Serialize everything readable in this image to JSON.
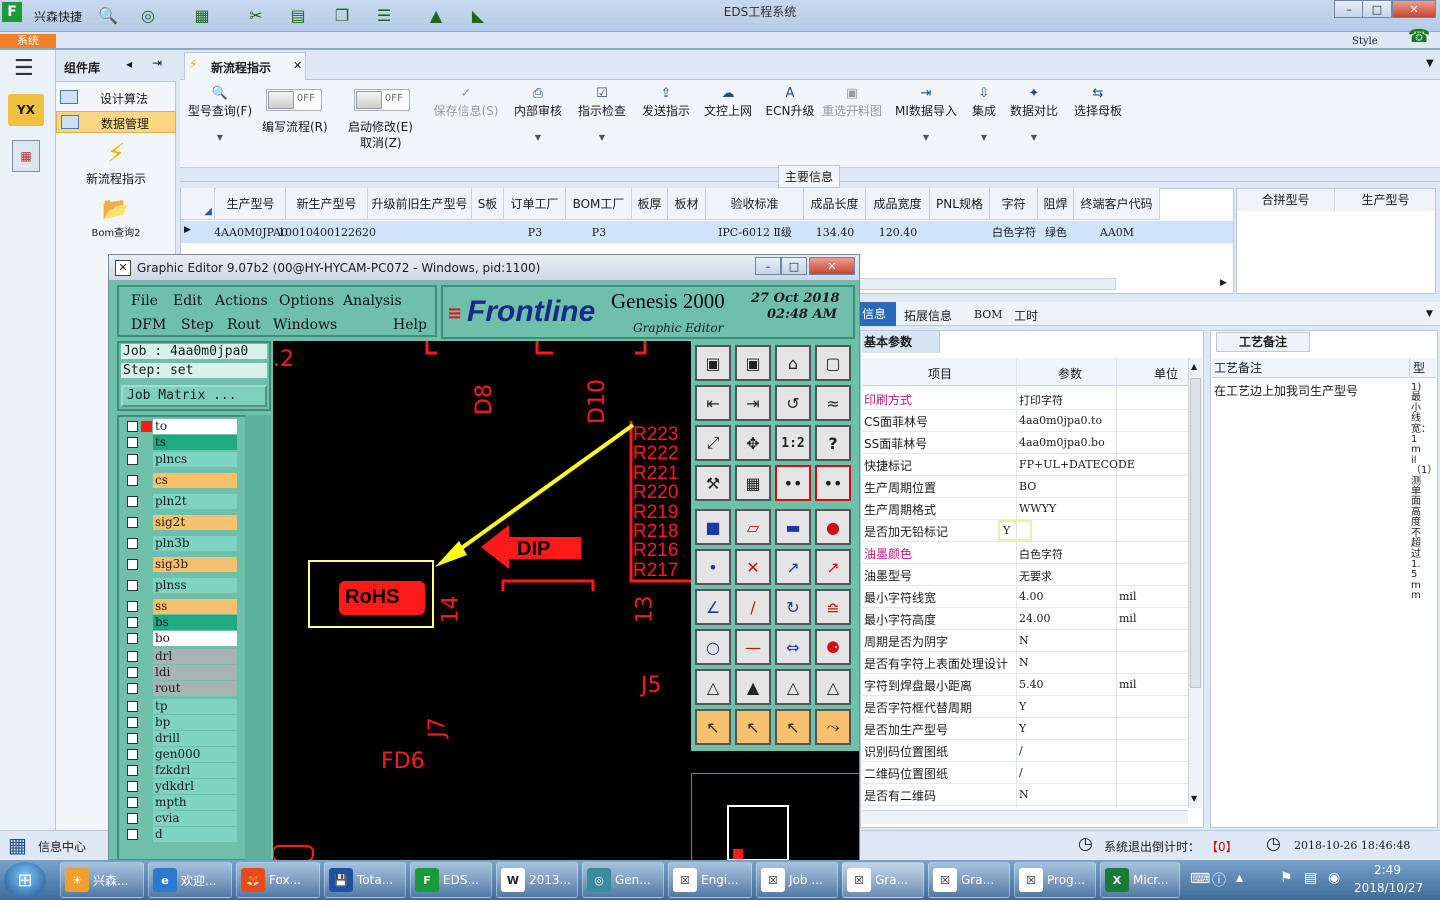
{
  "window": {
    "title": "EDS工程系统",
    "company": "兴森快捷",
    "theme_label": "Style",
    "tab_system": "系统"
  },
  "left_nav": {
    "header": "组件库",
    "items": [
      "设计算法",
      "数据管理"
    ],
    "tiles": [
      "新流程指示",
      "Bom查询2"
    ],
    "bottom": "信息中心"
  },
  "doc_tab": {
    "label": "新流程指示"
  },
  "ribbon": {
    "query": "型号查询(F)",
    "edit_toggle": {
      "state": "OFF",
      "label": "编写流程(R)"
    },
    "modify_toggle": {
      "state": "OFF",
      "label": "启动修改(E)",
      "sub": "取消(Z)"
    },
    "save": "保存信息(S)",
    "audit": "内部审核",
    "check": "指示检查",
    "send": "发送指示",
    "upload": "文控上网",
    "ecn": "ECN升级",
    "reselect": "重选开料图",
    "mi_import": "MI数据导入",
    "integrate": "集成",
    "compare": "数据对比",
    "mother": "选择母板"
  },
  "main_info_label": "主要信息",
  "table": {
    "headers": [
      "生产型号",
      "新生产型号",
      "升级前旧生产型号",
      "S板",
      "订单工厂",
      "BOM工厂",
      "板厚",
      "板材",
      "验收标准",
      "成品长度",
      "成品宽度",
      "PNL规格",
      "字符",
      "阻焊",
      "终端客户代码"
    ],
    "row": [
      "4AA0M0JPA0",
      "10010400122620",
      "",
      "",
      "P3",
      "P3",
      "",
      "",
      "IPC-6012 Ⅱ级",
      "134.40",
      "120.40",
      "",
      "白色字符",
      "绿色",
      "AA0M"
    ],
    "side_headers": [
      "合拼型号",
      "生产型号"
    ]
  },
  "detail_tabs": [
    "信息",
    "拓展信息",
    "BOM",
    "工时"
  ],
  "basic_params": {
    "title": "基本参数",
    "headers": [
      "项目",
      "参数",
      "单位"
    ],
    "rows": [
      {
        "name": "印刷方式",
        "value": "打印字符",
        "unit": "",
        "highlight": true
      },
      {
        "name": "CS面菲林号",
        "value": "4aa0m0jpa0.to",
        "unit": ""
      },
      {
        "name": "SS面菲林号",
        "value": "4aa0m0jpa0.bo",
        "unit": ""
      },
      {
        "name": "快捷标记",
        "value": "FP+UL+DATECODE",
        "unit": ""
      },
      {
        "name": "生产周期位置",
        "value": "BO",
        "unit": ""
      },
      {
        "name": "生产周期格式",
        "value": "WWYY",
        "unit": ""
      },
      {
        "name": "是否加无铅标记",
        "value": "Y",
        "unit": "",
        "boxed": true
      },
      {
        "name": "油墨颜色",
        "value": "白色字符",
        "unit": "",
        "highlight": true
      },
      {
        "name": "油墨型号",
        "value": "无要求",
        "unit": ""
      },
      {
        "name": "最小字符线宽",
        "value": "4.00",
        "unit": "mil"
      },
      {
        "name": "最小字符高度",
        "value": "24.00",
        "unit": "mil"
      },
      {
        "name": "周期是否为阴字",
        "value": "N",
        "unit": ""
      },
      {
        "name": "是否有字符上表面处理设计",
        "value": "N",
        "unit": ""
      },
      {
        "name": "字符到焊盘最小距离",
        "value": "5.40",
        "unit": "mil"
      },
      {
        "name": "是否字符框代替周期",
        "value": "Y",
        "unit": ""
      },
      {
        "name": "是否加生产型号",
        "value": "Y",
        "unit": ""
      },
      {
        "name": "识别码位置图纸",
        "value": "/",
        "unit": ""
      },
      {
        "name": "二维码位置图纸",
        "value": "/",
        "unit": ""
      },
      {
        "name": "是否有二维码",
        "value": "N",
        "unit": ""
      }
    ]
  },
  "process_notes": {
    "tab": "工艺备注",
    "header": "工艺备注",
    "col2": "型",
    "text": "在工艺边上加我司生产型号",
    "vertical_text": "1)最小线宽：1mil（1）测单面高度不超过1.5mm"
  },
  "status": {
    "logout_label": "系统退出倒计时：",
    "logout_value": "【0】",
    "datetime": "2018-10-26 18:46:48"
  },
  "graphic_editor": {
    "title": "Graphic Editor 9.07b2 (00@HY-HYCAM-PC072 - Windows, pid:1100)",
    "menu_row1": [
      "File",
      "Edit",
      "Actions",
      "Options",
      "Analysis"
    ],
    "menu_row2": [
      "DFM",
      "Step",
      "Rout",
      "Windows",
      "Help"
    ],
    "brand": "Frontline",
    "product": "Genesis 2000",
    "subtitle": "Graphic Editor",
    "date": "27 Oct 2018",
    "time": "02:48 AM",
    "job": "Job : 4aa0m0jpa0",
    "step": "Step: set",
    "matrix_btn": "Job Matrix ...",
    "layers": [
      {
        "name": "to",
        "color": "#ffffff"
      },
      {
        "name": "ts",
        "color": "#1faa80"
      },
      {
        "name": "plncs",
        "color": "#7fd3c3"
      },
      {
        "name": "cs",
        "color": "#f5c16f"
      },
      {
        "name": "pln2t",
        "color": "#7fd3c3"
      },
      {
        "name": "sig2t",
        "color": "#f5c16f"
      },
      {
        "name": "pln3b",
        "color": "#7fd3c3"
      },
      {
        "name": "sig3b",
        "color": "#f5c16f"
      },
      {
        "name": "plnss",
        "color": "#7fd3c3"
      },
      {
        "name": "ss",
        "color": "#f5c16f"
      },
      {
        "name": "bs",
        "color": "#1faa80"
      },
      {
        "name": "bo",
        "color": "#ffffff"
      },
      {
        "name": "drl",
        "color": "#a6b4b4"
      },
      {
        "name": "ldi",
        "color": "#a6b4b4"
      },
      {
        "name": "rout",
        "color": "#a6b4b4"
      },
      {
        "name": "tp",
        "color": "#7fd3c3"
      },
      {
        "name": "bp",
        "color": "#7fd3c3"
      },
      {
        "name": "drill",
        "color": "#7fd3c3"
      },
      {
        "name": "gen000",
        "color": "#7fd3c3"
      },
      {
        "name": "fzkdrl",
        "color": "#7fd3c3"
      },
      {
        "name": "ydkdrl",
        "color": "#7fd3c3"
      },
      {
        "name": "mpth",
        "color": "#7fd3c3"
      },
      {
        "name": "cvia",
        "color": "#7fd3c3"
      },
      {
        "name": "d",
        "color": "#7fd3c3"
      }
    ],
    "canvas_labels": {
      "rohs": "RoHS",
      "dip": "DIP",
      "fd6": "FD6",
      "j5": "J5",
      "j7": "J7",
      "n14": "14",
      "n13": "13",
      "n2": ".2",
      "d8": "D8",
      "d10": "D10",
      "refs": [
        "R223",
        "R222",
        "R221",
        "R220",
        "R219",
        "R218",
        "R216",
        "R217"
      ]
    },
    "tool_text": [
      "1:2",
      "?"
    ]
  },
  "taskbar": {
    "items": [
      "兴森...",
      "欢迎...",
      "Fox...",
      "Tota...",
      "EDS...",
      "2013...",
      "Gen...",
      "Engi...",
      "Job ...",
      "Gra...",
      "Gra...",
      "Prog...",
      "Micr..."
    ],
    "time": "2:49",
    "date": "2018/10/27"
  },
  "colors": {
    "accent": "#1e4e8c",
    "selection": "#cfe3fa",
    "canvas": "#000000",
    "pcb_red": "#ff1a1a",
    "arrow": "#ffff1a"
  }
}
